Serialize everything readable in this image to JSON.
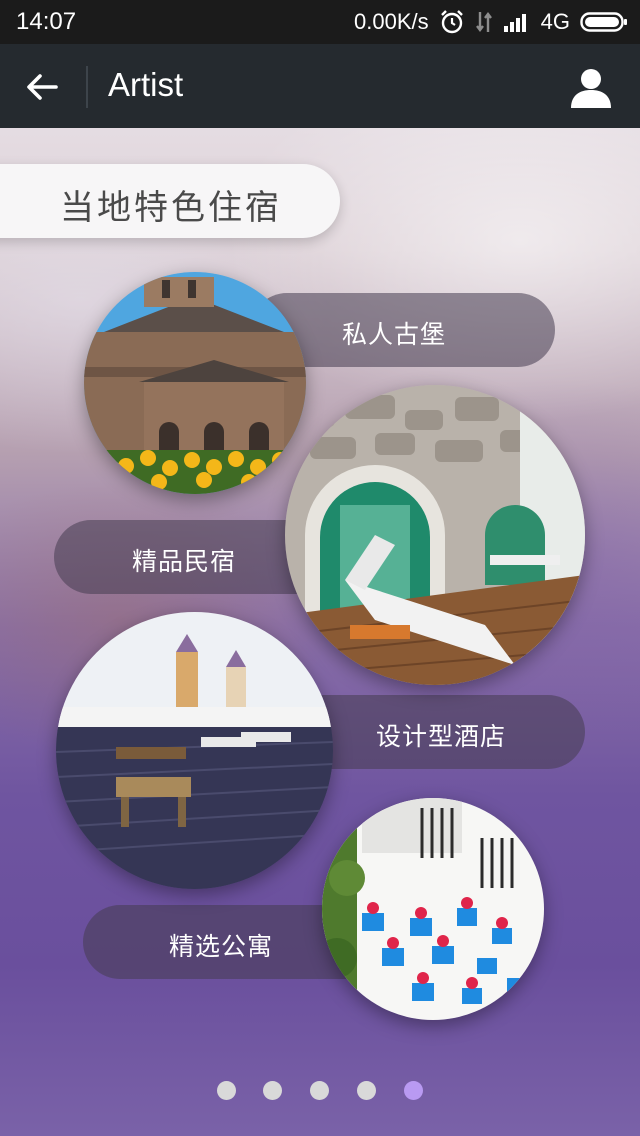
{
  "status_bar": {
    "time": "14:07",
    "network_speed": "0.00K/s",
    "network_type": "4G",
    "icons": [
      "alarm-icon",
      "data-transfer-icon",
      "signal-icon",
      "battery-icon"
    ]
  },
  "app_bar": {
    "title": "Artist",
    "back_icon": "arrow-left-icon",
    "user_icon": "user-icon"
  },
  "section_title": "当地特色住宿",
  "categories": [
    {
      "label": "私人古堡",
      "image": "castle-photo"
    },
    {
      "label": "精品民宿",
      "image": "stone-guesthouse-photo"
    },
    {
      "label": "设计型酒店",
      "image": "rooftop-terrace-photo"
    },
    {
      "label": "精选公寓",
      "image": "flower-pot-wall-photo"
    }
  ],
  "pagination": {
    "total": 5,
    "active_index": 5
  },
  "colors": {
    "status_bar": "#1b1b1b",
    "app_bar": "#252a2f",
    "active_dot": "#b99af2",
    "inactive_dot": "#d9d9d9"
  }
}
